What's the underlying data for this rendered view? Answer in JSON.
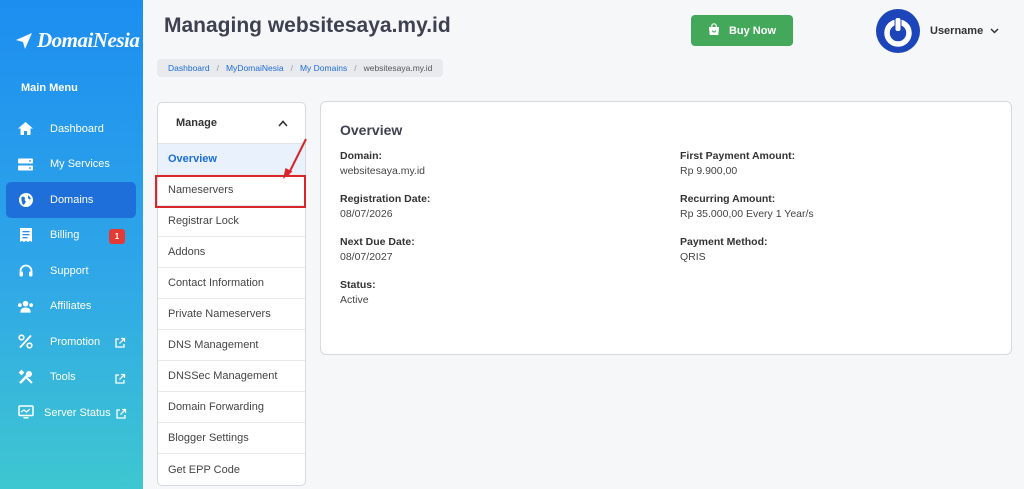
{
  "brand": {
    "logo_text": "DomaiNesia"
  },
  "sidebar": {
    "title": "Main Menu",
    "items": [
      {
        "label": "Dashboard",
        "icon": "home-icon"
      },
      {
        "label": "My Services",
        "icon": "server-stack-icon"
      },
      {
        "label": "Domains",
        "icon": "globe-icon"
      },
      {
        "label": "Billing",
        "icon": "receipt-icon",
        "badge": "1"
      },
      {
        "label": "Support",
        "icon": "headset-icon"
      },
      {
        "label": "Affiliates",
        "icon": "users-icon"
      },
      {
        "label": "Promotion",
        "icon": "percent-icon"
      },
      {
        "label": "Tools",
        "icon": "tools-icon"
      },
      {
        "label": "Server Status",
        "icon": "monitor-icon"
      }
    ]
  },
  "header": {
    "title": "Managing websitesaya.my.id",
    "buy_label": "Buy Now",
    "username": "Username"
  },
  "breadcrumb": [
    "Dashboard",
    "MyDomaiNesia",
    "My Domains",
    "websitesaya.my.id"
  ],
  "manage": {
    "title": "Manage",
    "items": [
      "Overview",
      "Nameservers",
      "Registrar Lock",
      "Addons",
      "Contact Information",
      "Private Nameservers",
      "DNS Management",
      "DNSSec Management",
      "Domain Forwarding",
      "Blogger Settings",
      "Get EPP Code"
    ]
  },
  "overview": {
    "title": "Overview",
    "domain_label": "Domain:",
    "domain_value": "websitesaya.my.id",
    "reg_label": "Registration Date:",
    "reg_value": "08/07/2026",
    "due_label": "Next Due Date:",
    "due_value": "08/07/2027",
    "status_label": "Status:",
    "status_value": "Active",
    "first_label": "First Payment Amount:",
    "first_value": "Rp 9.900,00",
    "recurring_label": "Recurring Amount:",
    "recurring_value": "Rp 35.000,00 Every 1 Year/s",
    "method_label": "Payment Method:",
    "method_value": "QRIS"
  },
  "colors": {
    "accent": "#1d6cd8",
    "buy": "#43a85a",
    "highlight": "#d8262a",
    "badge": "#e53935"
  }
}
